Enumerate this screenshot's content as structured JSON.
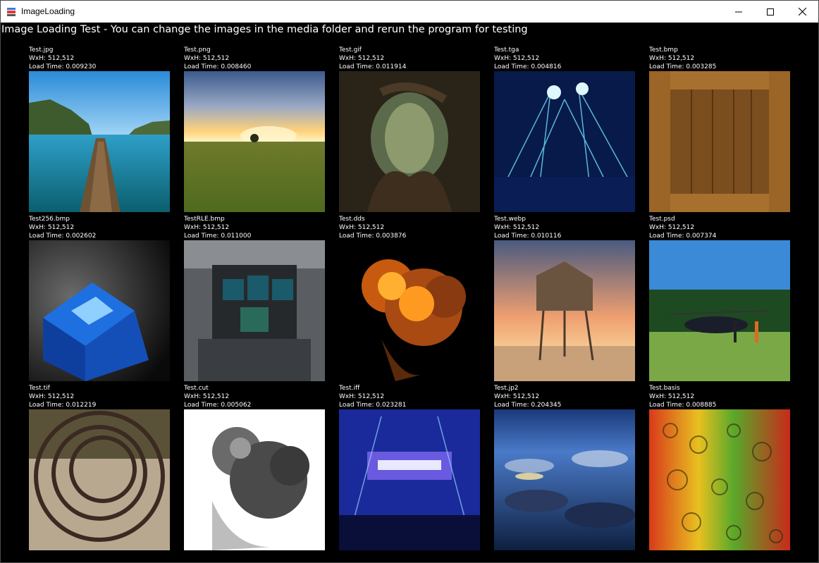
{
  "window": {
    "title": "ImageLoading"
  },
  "heading": "Image Loading Test - You can change the images in the media folder and rerun the program for testing",
  "images": [
    {
      "name": "Test.jpg",
      "size": "WxH: 512,512",
      "load_time": "Load Time: 0.009230",
      "icon": "pier-lake-photo"
    },
    {
      "name": "Test.png",
      "size": "WxH: 512,512",
      "load_time": "Load Time: 0.008460",
      "icon": "sunset-field-photo"
    },
    {
      "name": "Test.gif",
      "size": "WxH: 512,512",
      "load_time": "Load Time: 0.011914",
      "icon": "forest-cave-photo"
    },
    {
      "name": "Test.tga",
      "size": "WxH: 512,512",
      "load_time": "Load Time: 0.004816",
      "icon": "laser-concert-photo"
    },
    {
      "name": "Test.bmp",
      "size": "WxH: 512,512",
      "load_time": "Load Time: 0.003285",
      "icon": "wooden-crate-texture"
    },
    {
      "name": "Test256.bmp",
      "size": "WxH: 512,512",
      "load_time": "Load Time: 0.002602",
      "icon": "blue-cube-render"
    },
    {
      "name": "TestRLE.bmp",
      "size": "WxH: 512,512",
      "load_time": "Load Time: 0.011000",
      "icon": "cockpit-photo"
    },
    {
      "name": "Test.dds",
      "size": "WxH: 512,512",
      "load_time": "Load Time: 0.003876",
      "icon": "explosion-image"
    },
    {
      "name": "Test.webp",
      "size": "WxH: 512,512",
      "load_time": "Load Time: 0.010116",
      "icon": "stilt-house-photo"
    },
    {
      "name": "Test.psd",
      "size": "WxH: 512,512",
      "load_time": "Load Time: 0.007374",
      "icon": "helicopter-photo"
    },
    {
      "name": "Test.tif",
      "size": "WxH: 512,512",
      "load_time": "Load Time: 0.012219",
      "icon": "metal-rings-photo"
    },
    {
      "name": "Test.cut",
      "size": "WxH: 512,512",
      "load_time": "Load Time: 0.005062",
      "icon": "grayscale-explosion-image"
    },
    {
      "name": "Test.iff",
      "size": "WxH: 512,512",
      "load_time": "Load Time: 0.023281",
      "icon": "club-stage-photo"
    },
    {
      "name": "Test.jp2",
      "size": "WxH: 512,512",
      "load_time": "Load Time: 0.204345",
      "icon": "aerial-clouds-photo"
    },
    {
      "name": "Test.basis",
      "size": "WxH: 512,512",
      "load_time": "Load Time: 0.008885",
      "icon": "water-drops-photo"
    }
  ]
}
